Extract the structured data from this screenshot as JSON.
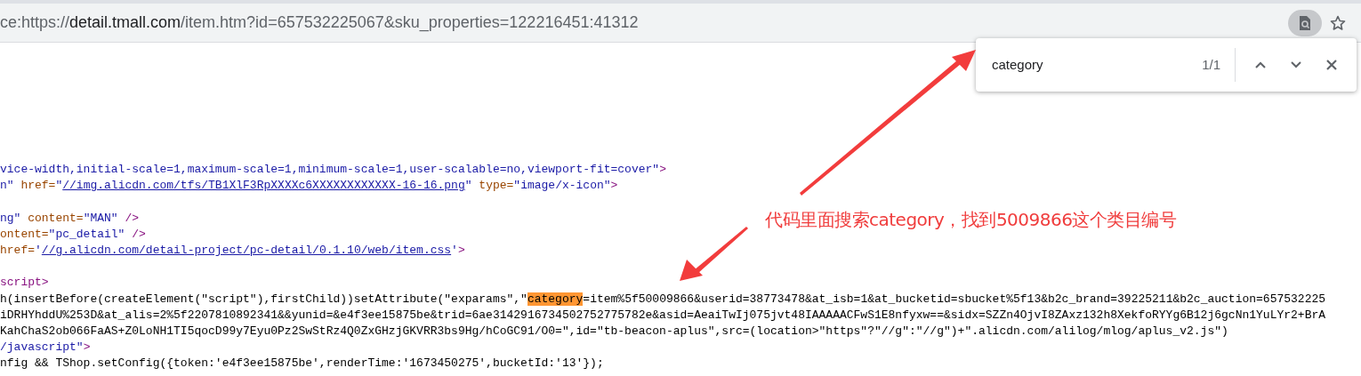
{
  "address_bar": {
    "url_prefix": "ce:https://",
    "url_host": "detail.tmall.com",
    "url_path": "/item.htm?id=657532225067&sku_properties=122216451:41312"
  },
  "find_bar": {
    "query": "category",
    "match_count": "1/1"
  },
  "source_lines": [
    {
      "kind": "code",
      "segments": [
        {
          "kind": "value",
          "text": "vice-width,initial-scale=1,maximum-scale=1,minimum-scale=1,user-scalable=no,viewport-fit=cover\""
        },
        {
          "kind": "tag",
          "text": ">"
        }
      ]
    },
    {
      "kind": "code",
      "segments": [
        {
          "kind": "value",
          "text": "n\""
        },
        {
          "kind": "attr",
          "text": " href="
        },
        {
          "kind": "value",
          "text": "\""
        },
        {
          "kind": "link",
          "text": "//img.alicdn.com/tfs/TB1XlF3RpXXXXc6XXXXXXXXXXXX-16-16.png"
        },
        {
          "kind": "value",
          "text": "\""
        },
        {
          "kind": "attr",
          "text": " type="
        },
        {
          "kind": "value",
          "text": "\"image/x-icon\""
        },
        {
          "kind": "tag",
          "text": ">"
        }
      ]
    },
    {
      "kind": "blank"
    },
    {
      "kind": "code",
      "segments": [
        {
          "kind": "value",
          "text": "ng\""
        },
        {
          "kind": "attr",
          "text": " content="
        },
        {
          "kind": "value",
          "text": "\"MAN\""
        },
        {
          "kind": "tag",
          "text": " />"
        }
      ]
    },
    {
      "kind": "code",
      "segments": [
        {
          "kind": "attr",
          "text": "ontent="
        },
        {
          "kind": "value",
          "text": "\"pc_detail\""
        },
        {
          "kind": "tag",
          "text": " />"
        }
      ]
    },
    {
      "kind": "code",
      "segments": [
        {
          "kind": "attr",
          "text": "href="
        },
        {
          "kind": "value",
          "text": "'"
        },
        {
          "kind": "link",
          "text": "//g.alicdn.com/detail-project/pc-detail/0.1.10/web/item.css"
        },
        {
          "kind": "value",
          "text": "'"
        },
        {
          "kind": "tag",
          "text": ">"
        }
      ]
    },
    {
      "kind": "blank"
    },
    {
      "kind": "code",
      "segments": [
        {
          "kind": "tag",
          "text": "script>"
        }
      ]
    },
    {
      "kind": "code",
      "segments": [
        {
          "kind": "text",
          "text": "h(insertBefore(createElement(\"script\"),firstChild))setAttribute(\"exparams\",\""
        },
        {
          "kind": "match",
          "text": "category"
        },
        {
          "kind": "text",
          "text": "=item%5f50009866&userid=38773478&at_isb=1&at_bucketid=sbucket%5f13&b2c_brand=39225211&b2c_auction=657532225"
        }
      ]
    },
    {
      "kind": "code",
      "segments": [
        {
          "kind": "text",
          "text": "iDRHYhddU%253D&at_alis=2%5f2207810892341&&yunid=&e4f3ee15875be&trid=6ae3142916734502752775782e&asid=AeaiTwIj075jvt48IAAAAACFwS1E8nfyxw==&sidx=SZZn4OjvI8ZAxz132h8XekfoRYYg6B12j6gcNn1YuLYr2+BrA"
        }
      ]
    },
    {
      "kind": "code",
      "segments": [
        {
          "kind": "text",
          "text": "KahChaS2ob066FaAS+Z0LoNH1TI5qocD99y7Eyu0Pz2SwStRz4Q0ZxGHzjGKVRR3bs9Hg/hCoGC91/O0=\",id=\"tb-beacon-aplus\",src=(location>\"https\"?\"//g\":\"//g\")+\".alicdn.com/alilog/mlog/aplus_v2.js\")"
        }
      ]
    },
    {
      "kind": "code",
      "segments": [
        {
          "kind": "value",
          "text": "/javascript\""
        },
        {
          "kind": "tag",
          "text": ">"
        }
      ]
    },
    {
      "kind": "code",
      "segments": [
        {
          "kind": "text",
          "text": "nfig && TShop.setConfig({token:'e4f3ee15875be',renderTime:'1673450275',bucketId:'13'});"
        }
      ]
    }
  ],
  "annotation": {
    "text": "代码里面搜索category，找到5009866这个类目编号"
  }
}
